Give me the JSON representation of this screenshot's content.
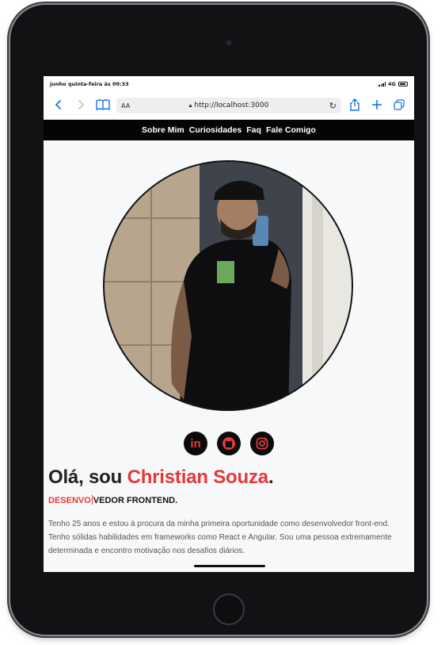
{
  "statusbar": {
    "time_text": "junho quinta-feira às 09:33",
    "network": "4G"
  },
  "browser": {
    "text_size_label": "AA",
    "url": "http://localhost:3000",
    "icons": [
      "chevron-left-icon",
      "chevron-right-icon",
      "book-icon",
      "lock-icon",
      "reload-icon",
      "share-icon",
      "plus-icon",
      "tabs-icon"
    ],
    "accent_color": "#1a73e8"
  },
  "site_nav": {
    "items": [
      {
        "label": "Sobre Mim"
      },
      {
        "label": "Curiosidades"
      },
      {
        "label": "Faq"
      },
      {
        "label": "Fale Comigo"
      }
    ]
  },
  "hero": {
    "socials": [
      {
        "label": "in",
        "icon": "linkedin-icon"
      },
      {
        "label": "",
        "icon": "github-icon"
      },
      {
        "label": "",
        "icon": "instagram-icon"
      }
    ],
    "greeting_prefix": "Olá, sou ",
    "name": "Christian Souza",
    "greeting_suffix": ".",
    "role_typed": "DESENVO",
    "role_rest": "VEDOR FRONTEND.",
    "bio": "Tenho 25 anos e estou à procura da minha primeira oportunidade como desenvolvedor front-end. Tenho sólidas habilidades em frameworks como React e Angular. Sou uma pessoa extremamente determinada e encontro motivação nos desafios diários.",
    "accent_color": "#e5383b"
  }
}
